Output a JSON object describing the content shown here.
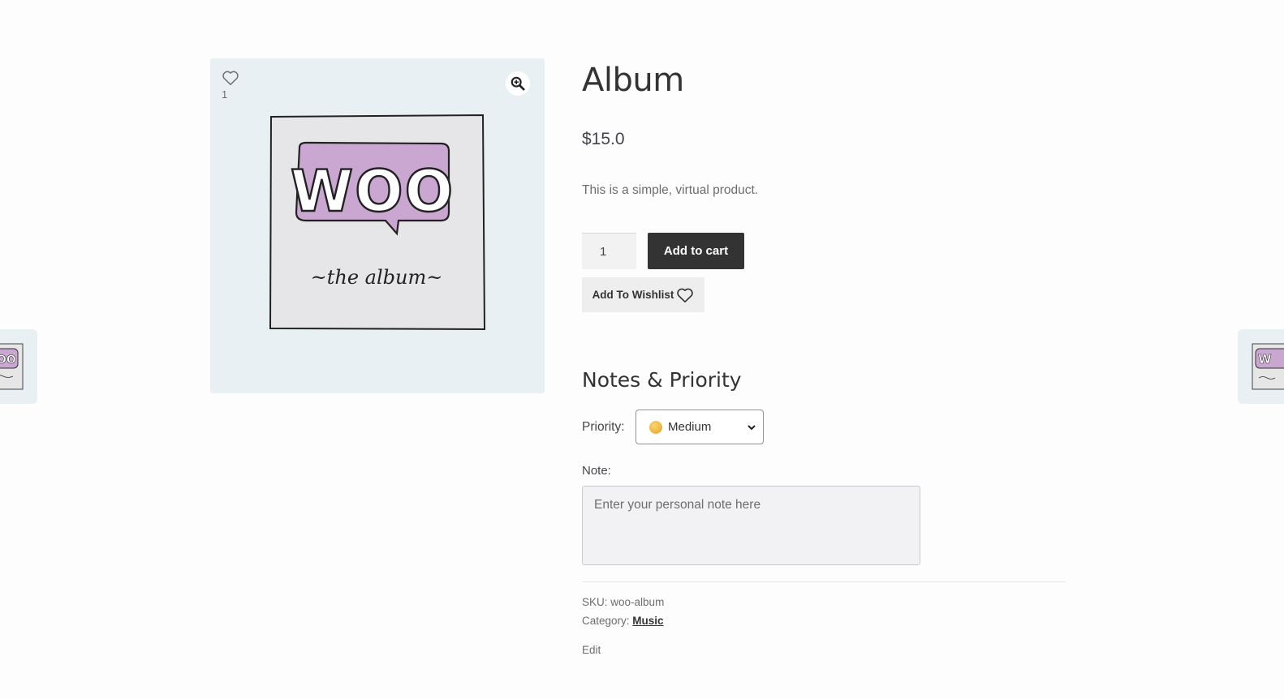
{
  "product": {
    "title": "Album",
    "price": "$15.0",
    "description": "This is a simple, virtual product."
  },
  "gallery": {
    "wishlist_count": "1",
    "zoom_icon": "magnifier-plus-icon",
    "image_text_main": "WOO",
    "image_text_sub": "~the album~"
  },
  "cart": {
    "quantity": "1",
    "add_to_cart_label": "Add to cart",
    "wishlist_label": "Add To Wishlist"
  },
  "notes": {
    "heading": "Notes & Priority",
    "priority_label": "Priority:",
    "priority_value": "Medium",
    "note_label": "Note:",
    "note_placeholder": "Enter your personal note here"
  },
  "meta": {
    "sku_label": "SKU:",
    "sku_value": "woo-album",
    "category_label": "Category:",
    "category_value": "Music",
    "edit_label": "Edit"
  },
  "colors": {
    "button_dark": "#333333",
    "gallery_bg": "#e8f0f4",
    "woo_purple": "#c9a7d0"
  }
}
